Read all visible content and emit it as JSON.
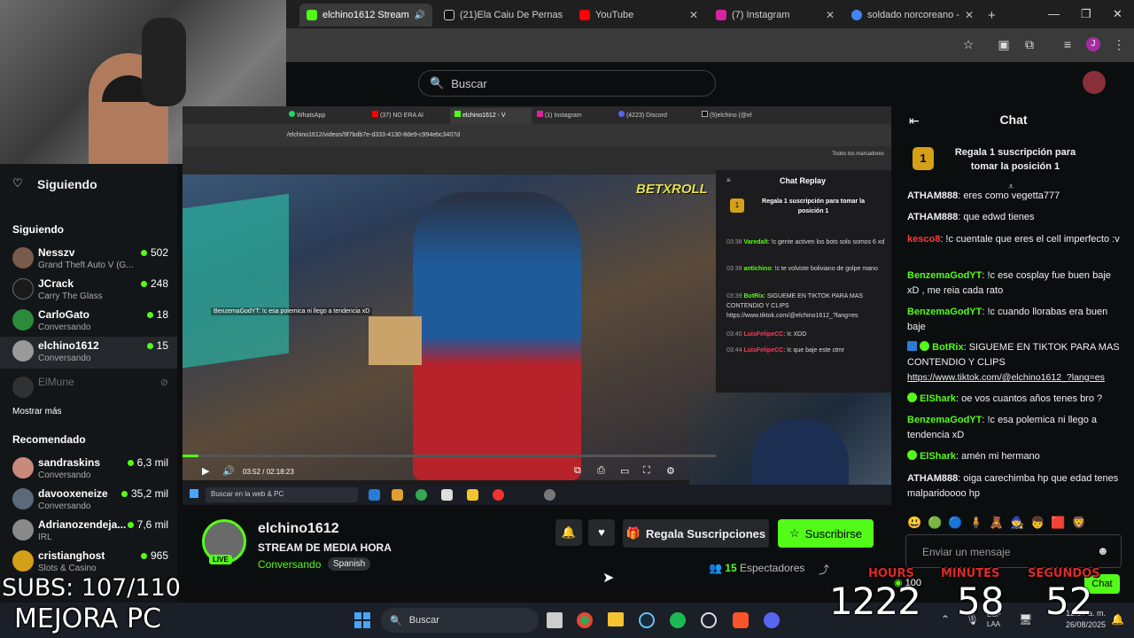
{
  "browser": {
    "tabs": [
      {
        "label": "elchino1612 Stream",
        "color": "#53fc18",
        "active": true
      },
      {
        "label": "(21)Ela Caiu De Pernas",
        "color": "#111111"
      },
      {
        "label": "YouTube",
        "color": "#ff0000"
      },
      {
        "label": "(7) Instagram",
        "color": "#d6249f"
      },
      {
        "label": "soldado norcoreano -",
        "color": "#4285f4"
      }
    ],
    "new_tab": "+",
    "profile_initial": "J"
  },
  "header": {
    "search_placeholder": "Buscar"
  },
  "sidebar": {
    "following_title": "Siguiendo",
    "following_heading": "Siguiendo",
    "following": [
      {
        "name": "Nesszv",
        "sub": "Grand Theft Auto V (G...",
        "count": "502"
      },
      {
        "name": "JCrack",
        "sub": "Carry The Glass",
        "count": "248"
      },
      {
        "name": "CarloGato",
        "sub": "Conversando",
        "count": "18"
      },
      {
        "name": "elchino1612",
        "sub": "Conversando",
        "count": "15"
      }
    ],
    "offline": "ElMune",
    "show_more": "Mostrar más",
    "recommended_heading": "Recomendado",
    "recommended": [
      {
        "name": "sandraskins",
        "sub": "Conversando",
        "count": "6,3 mil"
      },
      {
        "name": "davooxeneize",
        "sub": "Conversando",
        "count": "35,2 mil"
      },
      {
        "name": "Adrianozendeja...",
        "sub": "IRL",
        "count": "7,6 mil"
      },
      {
        "name": "cristianghost",
        "sub": "Slots & Casino",
        "count": "965"
      }
    ]
  },
  "video": {
    "inner_tabs": [
      "WhatsApp",
      "(37) NO ERA AI",
      "elchino1612 - V",
      "(1) Instagram",
      "(4223) Discord",
      "(5)elchino (@el"
    ],
    "inner_url": "/elchino1612/videos/9f7bdb7e-d333-4130-8de9-c994ebc3407d",
    "inner_bookmarks": "Todos los marcadores",
    "overlay_chat": "BenzemaGodYT: !c esa polemica ni llego a tendencia xD",
    "brand": "BETXROLL",
    "time": "03:52 / 02:18:23",
    "replay": {
      "title": "Chat Replay",
      "promo": "Regala 1 suscripción para tomar la posición 1",
      "messages": [
        {
          "t": "03:38",
          "user": "Varedalt",
          "text": ": !c gente activen los bots solo somos 6 xd"
        },
        {
          "t": "03:39",
          "user": "antichino",
          "text": ": !c te volviste boliviano de golpe mano"
        },
        {
          "t": "03:39",
          "user": "BotRix",
          "text": ": SIGUEME EN TIKTOK PARA MAS CONTENDIO Y CLIPS https://www.tiktok.com/@elchino1612_?lang=es"
        },
        {
          "t": "03:40",
          "user": "LuisFelipeCC",
          "text": ": !c XDD"
        },
        {
          "t": "03:44",
          "user": "LuisFelipeCC",
          "text": ": !c que baje este ctmr"
        }
      ]
    },
    "inner_search": "Buscar en la web & PC"
  },
  "stream": {
    "channel": "elchino1612",
    "title": "STREAM DE MEDIA HORA",
    "category": "Conversando",
    "language": "Spanish",
    "live": "LIVE",
    "gift_label": "Regala Suscripciones",
    "subscribe_label": "Suscribirse",
    "viewers": "15",
    "viewers_label": "Espectadores"
  },
  "chat": {
    "title": "Chat",
    "promo": "Regala 1 suscripción para tomar la posición 1",
    "promo_rank": "1",
    "messages": [
      {
        "user": "ATHAM888",
        "color": "#ffffff",
        "text": ": eres como vegetta777"
      },
      {
        "user": "ATHAM888",
        "color": "#ffffff",
        "text": ": que edwd tienes"
      },
      {
        "user": "kesco8",
        "color": "#ff3b3b",
        "text": ": !c cuentale que eres el cell imperfecto :v"
      },
      {
        "user": "BenzemaGodYT",
        "color": "#53fc18",
        "text": ": !c ese cosplay fue buen baje xD , me reia cada rato"
      },
      {
        "user": "BenzemaGodYT",
        "color": "#53fc18",
        "text": ": !c cuando llorabas era buen baje"
      },
      {
        "user": "BotRix",
        "color": "#53fc18",
        "text": ": SIGUEME EN TIKTOK PARA MAS CONTENDIO Y CLIPS",
        "link": "https://www.tiktok.com/@elchino1612_?lang=es"
      },
      {
        "user": "ElShark",
        "color": "#53fc18",
        "text": ": oe vos cuantos años tenes bro ?"
      },
      {
        "user": "BenzemaGodYT",
        "color": "#53fc18",
        "text": ": !c esa polemica ni llego a tendencia xD"
      },
      {
        "user": "ElShark",
        "color": "#53fc18",
        "text": ": amén mi hermano"
      },
      {
        "user": "ATHAM888",
        "color": "#ffffff",
        "text": ": oiga carechimba hp que edad tenes malparidoooo hp"
      }
    ],
    "input_placeholder": "Enviar un mensaje",
    "points": "100",
    "send_label": "Chat"
  },
  "overlay": {
    "subs": "SUBS: 107/110",
    "mejora": "MEJORA PC",
    "hours_label": "HOURS",
    "minutes_label": "MINUTES",
    "seconds_label": "SEGUNDOS",
    "hours": "1222",
    "minutes": "58",
    "seconds": "52"
  },
  "taskbar": {
    "search": "Buscar",
    "lang": "ESP LAA",
    "time": "12:57 a. m.",
    "date": "26/08/2025"
  }
}
